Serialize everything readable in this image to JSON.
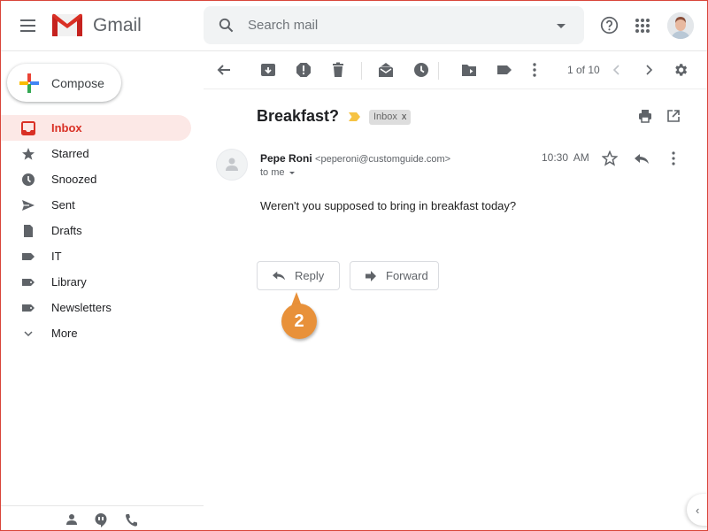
{
  "app": {
    "name": "Gmail"
  },
  "header": {
    "search_placeholder": "Search mail",
    "icons": [
      "menu-icon",
      "search-icon",
      "search-options-icon",
      "help-icon",
      "apps-icon",
      "account-avatar"
    ]
  },
  "sidebar": {
    "compose_label": "Compose",
    "items": [
      {
        "label": "Inbox",
        "icon": "inbox-icon",
        "active": true
      },
      {
        "label": "Starred",
        "icon": "star-icon"
      },
      {
        "label": "Snoozed",
        "icon": "clock-icon"
      },
      {
        "label": "Sent",
        "icon": "send-icon"
      },
      {
        "label": "Drafts",
        "icon": "draft-icon"
      },
      {
        "label": "IT",
        "icon": "label-icon"
      },
      {
        "label": "Library",
        "icon": "label-icon"
      },
      {
        "label": "Newsletters",
        "icon": "label-icon"
      },
      {
        "label": "More",
        "icon": "chevron-down-icon"
      }
    ],
    "footer_icons": [
      "contacts-icon",
      "hangouts-icon",
      "phone-icon"
    ]
  },
  "toolbar": {
    "pager": "1 of 10",
    "icons": [
      "back-arrow-icon",
      "archive-icon",
      "report-spam-icon",
      "delete-icon",
      "mark-unread-icon",
      "snooze-icon",
      "move-to-icon",
      "labels-icon",
      "more-vert-icon",
      "prev-icon",
      "next-icon",
      "settings-icon"
    ]
  },
  "message": {
    "subject": "Breakfast?",
    "label_chip": "Inbox",
    "label_remove": "x",
    "sender_name": "Pepe Roni",
    "sender_email": "<peperoni@customguide.com>",
    "to": "to me",
    "time": "10:30 AM",
    "body": "Weren't you supposed to bring in breakfast today?",
    "reply_label": "Reply",
    "forward_label": "Forward"
  },
  "callout": {
    "number": "2",
    "color": "#e8913a"
  },
  "colors": {
    "accent": "#d93025",
    "active_bg": "#fce8e6",
    "icon_gray": "#5f6368"
  }
}
